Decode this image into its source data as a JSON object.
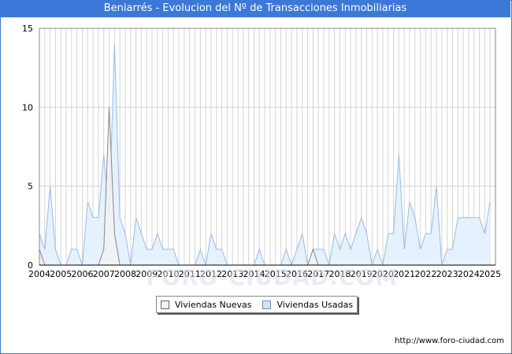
{
  "chart_data": {
    "type": "area",
    "title": "Beniarrés - Evolucion del Nº de Transacciones Inmobiliarias",
    "x_tick_labels": [
      "2004",
      "2005",
      "2006",
      "2007",
      "2008",
      "2009",
      "2010",
      "2011",
      "2012",
      "2013",
      "2014",
      "2015",
      "2016",
      "2017",
      "2018",
      "2019",
      "2020",
      "2021",
      "2022",
      "2023",
      "2024",
      "2025"
    ],
    "x_range": [
      2004,
      2025.25
    ],
    "ylim": [
      0,
      15
    ],
    "y_ticks": [
      0,
      5,
      10,
      15
    ],
    "grid": true,
    "legend_position": "bottom-center",
    "series": [
      {
        "name": "Viviendas Nuevas",
        "color": "#888888",
        "fill": "#f2f2f2",
        "points": [
          [
            2004.0,
            1
          ],
          [
            2004.25,
            0
          ],
          [
            2006.75,
            0
          ],
          [
            2007.0,
            1
          ],
          [
            2007.25,
            10
          ],
          [
            2007.5,
            2
          ],
          [
            2007.75,
            0
          ],
          [
            2016.5,
            0
          ],
          [
            2016.75,
            1
          ],
          [
            2017.0,
            0
          ],
          [
            2025.25,
            0
          ]
        ]
      },
      {
        "name": "Viviendas Usadas",
        "color": "#99bbe8",
        "fill": "#e5f1fd",
        "values": [
          2,
          1,
          5,
          1,
          0,
          0,
          1,
          1,
          0,
          4,
          3,
          3,
          7,
          3,
          14,
          3,
          2,
          0,
          3,
          2,
          1,
          1,
          2,
          1,
          1,
          1,
          0,
          0,
          0,
          0,
          1,
          0,
          2,
          1,
          1,
          0,
          0,
          0,
          0,
          0,
          0,
          1,
          0,
          0,
          0,
          0,
          1,
          0,
          1,
          2,
          0,
          1,
          1,
          1,
          0,
          2,
          1,
          2,
          1,
          2,
          3,
          2,
          0,
          1,
          0,
          2,
          2,
          7,
          1,
          4,
          3,
          1,
          2,
          2,
          5,
          0,
          1,
          1,
          3,
          3,
          3,
          3,
          3,
          2,
          4
        ]
      }
    ]
  },
  "legend": {
    "items": [
      "Viviendas Nuevas",
      "Viviendas Usadas"
    ]
  },
  "footer": {
    "url": "http://www.foro-ciudad.com"
  },
  "watermark": {
    "text": "FORO-CIUDAD.COM"
  }
}
